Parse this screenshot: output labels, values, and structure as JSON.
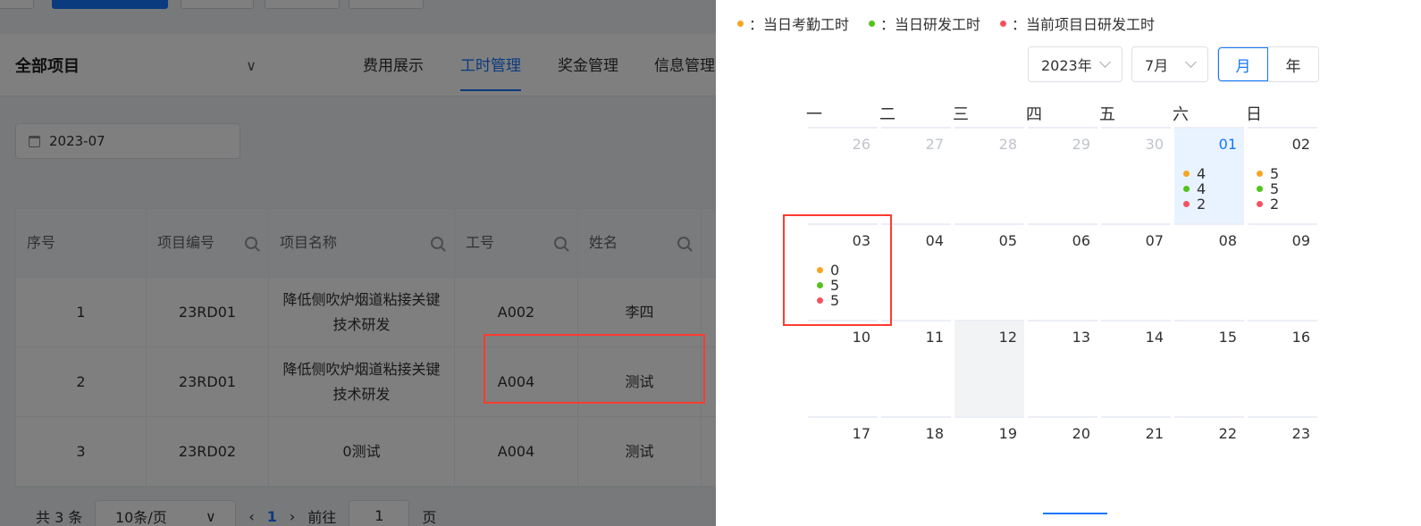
{
  "page": {
    "project_select": "全部项目",
    "nav_tabs": [
      "费用展示",
      "工时管理",
      "奖金管理",
      "信息管理"
    ],
    "active_tab": "工时管理",
    "date_filter": "2023-07",
    "table": {
      "headers": [
        "序号",
        "项目编号",
        "项目名称",
        "工号",
        "姓名"
      ],
      "rows": [
        {
          "no": "1",
          "code": "23RD01",
          "name": "降低侧吹炉烟道粘接关键技术研发",
          "emp_id": "A002",
          "emp_name": "李四"
        },
        {
          "no": "2",
          "code": "23RD01",
          "name": "降低侧吹炉烟道粘接关键技术研发",
          "emp_id": "A004",
          "emp_name": "测试"
        },
        {
          "no": "3",
          "code": "23RD02",
          "name": "0测试",
          "emp_id": "A004",
          "emp_name": "测试"
        }
      ]
    },
    "pager": {
      "total": "共 3 条",
      "page_size": "10条/页",
      "current": "1",
      "goto_label": "前往",
      "goto_value": "1",
      "page_suffix": "页"
    }
  },
  "drawer": {
    "legend": [
      {
        "label": "：当日考勤工时",
        "color": "#f5a623"
      },
      {
        "label": "：当日研发工时",
        "color": "#52c41a"
      },
      {
        "label": "：当前项目日研发工时",
        "color": "#f5515f"
      }
    ],
    "year_select": "2023年",
    "month_select": "7月",
    "view_month": "月",
    "view_year": "年",
    "weekdays": [
      "一",
      "二",
      "三",
      "四",
      "五",
      "六",
      "日"
    ],
    "days": [
      {
        "n": "26",
        "prev": true
      },
      {
        "n": "27",
        "prev": true
      },
      {
        "n": "28",
        "prev": true
      },
      {
        "n": "29",
        "prev": true
      },
      {
        "n": "30",
        "prev": true
      },
      {
        "n": "01",
        "selected": true,
        "vals": [
          "4",
          "4",
          "2"
        ]
      },
      {
        "n": "02",
        "vals": [
          "5",
          "5",
          "2"
        ]
      },
      {
        "n": "03",
        "vals": [
          "0",
          "5",
          "5"
        ]
      },
      {
        "n": "04"
      },
      {
        "n": "05"
      },
      {
        "n": "06"
      },
      {
        "n": "07"
      },
      {
        "n": "08"
      },
      {
        "n": "09"
      },
      {
        "n": "10"
      },
      {
        "n": "11"
      },
      {
        "n": "12",
        "today": true
      },
      {
        "n": "13"
      },
      {
        "n": "14"
      },
      {
        "n": "15"
      },
      {
        "n": "16"
      },
      {
        "n": "17"
      },
      {
        "n": "18"
      },
      {
        "n": "19"
      },
      {
        "n": "20"
      },
      {
        "n": "21"
      },
      {
        "n": "22"
      },
      {
        "n": "23"
      }
    ],
    "colors": {
      "attendance": "#f5a623",
      "rd": "#52c41a",
      "project_rd": "#f5515f"
    }
  }
}
